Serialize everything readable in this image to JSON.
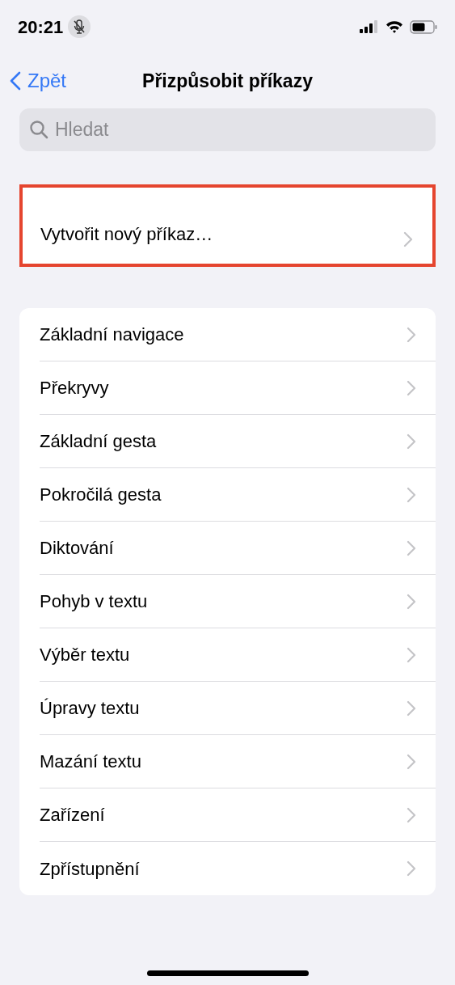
{
  "status_bar": {
    "time": "20:21"
  },
  "nav": {
    "back": "Zpět",
    "title": "Přizpůsobit příkazy"
  },
  "search": {
    "placeholder": "Hledat"
  },
  "create": {
    "label": "Vytvořit nový příkaz…",
    "highlighted": true
  },
  "items": [
    {
      "label": "Základní navigace"
    },
    {
      "label": "Překryvy"
    },
    {
      "label": "Základní gesta"
    },
    {
      "label": "Pokročilá gesta"
    },
    {
      "label": "Diktování"
    },
    {
      "label": "Pohyb v textu"
    },
    {
      "label": "Výběr textu"
    },
    {
      "label": "Úpravy textu"
    },
    {
      "label": "Mazání textu"
    },
    {
      "label": "Zařízení"
    },
    {
      "label": "Zpřístupnění"
    }
  ]
}
